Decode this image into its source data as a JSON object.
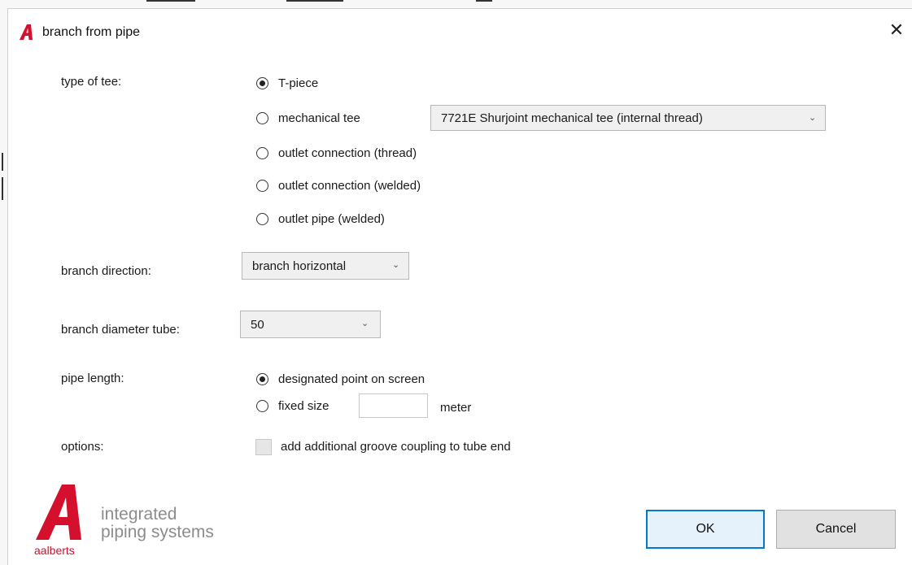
{
  "window": {
    "title": "branch from pipe",
    "close_glyph": "✕"
  },
  "brand": {
    "logo_icon": "aalberts-a-logo",
    "line1": "integrated",
    "line2": "piping systems",
    "wordmark": "aalberts",
    "color": "#d4102d"
  },
  "type_of_tee": {
    "label": "type of tee:",
    "options": [
      {
        "label": "T-piece",
        "checked": true
      },
      {
        "label": "mechanical tee",
        "checked": false
      },
      {
        "label": "outlet connection (thread)",
        "checked": false
      },
      {
        "label": "outlet connection (welded)",
        "checked": false
      },
      {
        "label": "outlet pipe (welded)",
        "checked": false
      }
    ],
    "mechanical_tee_select": "7721E Shurjoint mechanical tee (internal thread)"
  },
  "branch_direction": {
    "label": "branch direction:",
    "value": "branch horizontal"
  },
  "branch_diameter": {
    "label": "branch diameter tube:",
    "value": "50"
  },
  "pipe_length": {
    "label": "pipe length:",
    "options": [
      {
        "label": "designated point on screen",
        "checked": true
      },
      {
        "label": "fixed size",
        "checked": false
      }
    ],
    "fixed_size_value": "",
    "unit": "meter"
  },
  "options": {
    "label": "options:",
    "checkbox_label": "add additional groove coupling to tube end",
    "checked": false
  },
  "buttons": {
    "ok": "OK",
    "cancel": "Cancel"
  },
  "icons": {
    "dropdown": "chevron-down-icon",
    "close": "close-icon"
  },
  "colors": {
    "accent": "#0078d7",
    "brand_red": "#d4102d"
  }
}
